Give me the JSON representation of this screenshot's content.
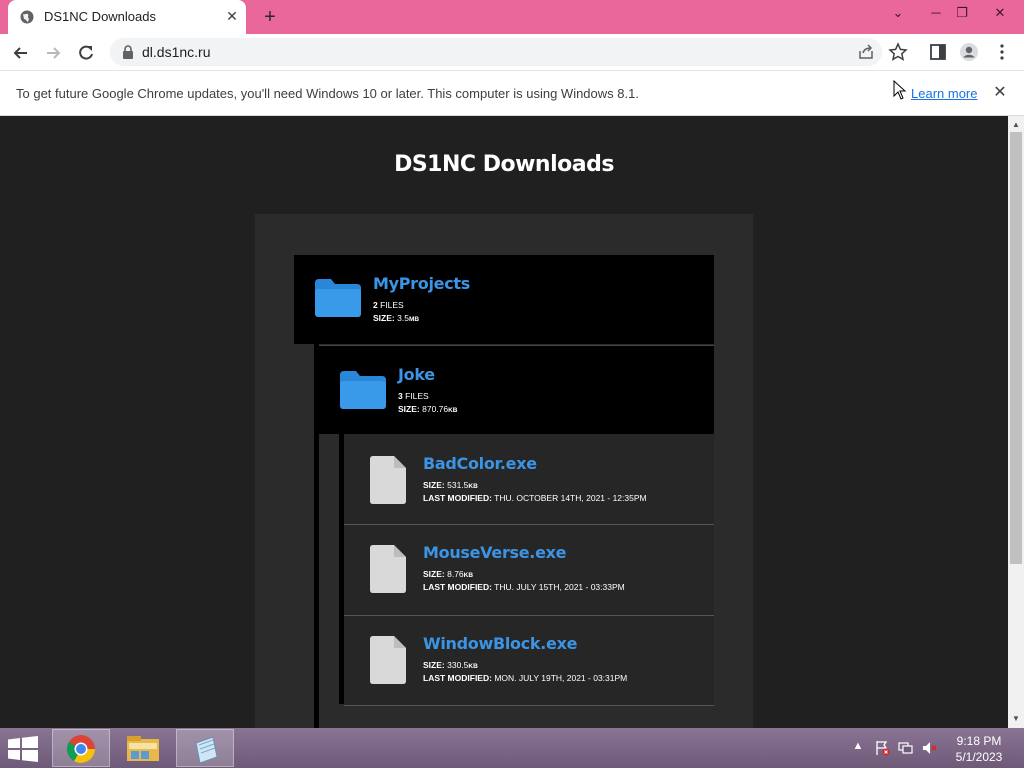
{
  "browser": {
    "tab": {
      "title": "DS1NC Downloads"
    },
    "url": "dl.ds1nc.ru",
    "infobar": {
      "message": "To get future Google Chrome updates, you'll need Windows 10 or later. This computer is using Windows 8.1.",
      "link": "Learn more"
    }
  },
  "page": {
    "title": "DS1NC Downloads",
    "folders": [
      {
        "name": "MyProjects",
        "files_count": "2",
        "files_label": "FILES",
        "size_label": "SIZE:",
        "size": "3.5",
        "size_unit": "MB"
      },
      {
        "name": "Joke",
        "files_count": "3",
        "files_label": "FILES",
        "size_label": "SIZE:",
        "size": "870.76",
        "size_unit": "KB"
      }
    ],
    "files": [
      {
        "name": "BadColor.exe",
        "size_label": "SIZE:",
        "size": "531.5",
        "size_unit": "KB",
        "modified_label": "LAST MODIFIED:",
        "modified": "THU. OCTOBER 14TH, 2021 - 12:35PM"
      },
      {
        "name": "MouseVerse.exe",
        "size_label": "SIZE:",
        "size": "8.76",
        "size_unit": "KB",
        "modified_label": "LAST MODIFIED:",
        "modified": "THU. JULY 15TH, 2021 - 03:33PM"
      },
      {
        "name": "WindowBlock.exe",
        "size_label": "SIZE:",
        "size": "330.5",
        "size_unit": "KB",
        "modified_label": "LAST MODIFIED:",
        "modified": "MON. JULY 19TH, 2021 - 03:31PM"
      }
    ]
  },
  "taskbar": {
    "time": "9:18 PM",
    "date": "5/1/2023"
  },
  "colors": {
    "accent_link": "#3b95e4",
    "tabstrip": "#e9679a",
    "page_bg": "#202020"
  },
  "icons": [
    "chrome-favicon",
    "back-icon",
    "forward-icon",
    "reload-icon",
    "lock-icon",
    "share-icon",
    "star-icon",
    "sidepanel-icon",
    "profile-icon",
    "menu-icon",
    "folder-icon",
    "file-icon",
    "windows-start-icon",
    "chrome-icon",
    "file-explorer-icon",
    "notepad-icon"
  ]
}
